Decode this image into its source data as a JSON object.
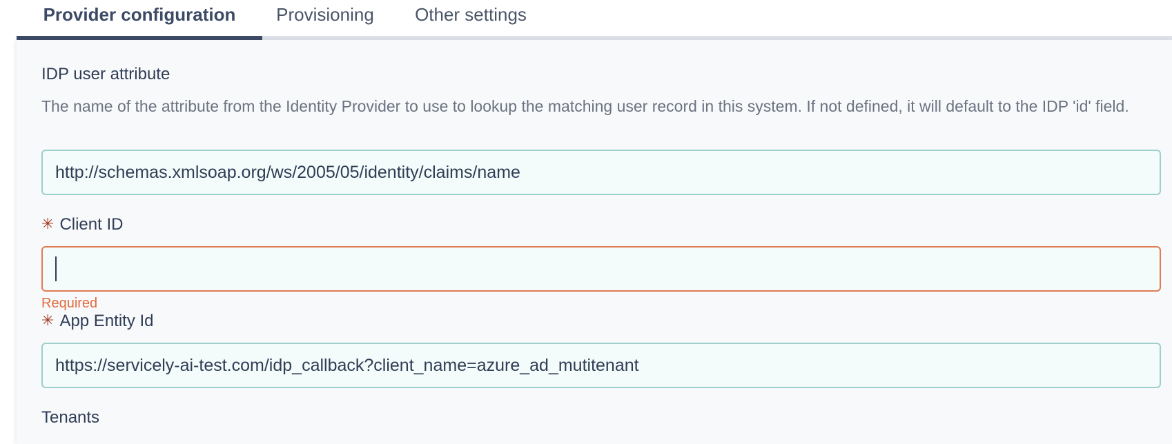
{
  "tabs": [
    {
      "label": "Provider configuration",
      "active": true
    },
    {
      "label": "Provisioning",
      "active": false
    },
    {
      "label": "Other settings",
      "active": false
    }
  ],
  "form": {
    "idp_user_attribute": {
      "label": "IDP user attribute",
      "help": "The name of the attribute from the Identity Provider to use to lookup the matching user record in this system. If not defined, it will default to the IDP 'id' field.",
      "value": "http://schemas.xmlsoap.org/ws/2005/05/identity/claims/name"
    },
    "client_id": {
      "label": "Client ID",
      "required_marker": "✳",
      "value": "",
      "error": "Required"
    },
    "app_entity_id": {
      "label": "App Entity Id",
      "required_marker": "✳",
      "value": "https://servicely-ai-test.com/idp_callback?client_name=azure_ad_mutitenant"
    },
    "tenants": {
      "label": "Tenants"
    }
  },
  "colors": {
    "accent": "#3d4a66",
    "input_border": "#9dcfcb",
    "error": "#e06b3d",
    "required_star": "#a23a1e"
  }
}
